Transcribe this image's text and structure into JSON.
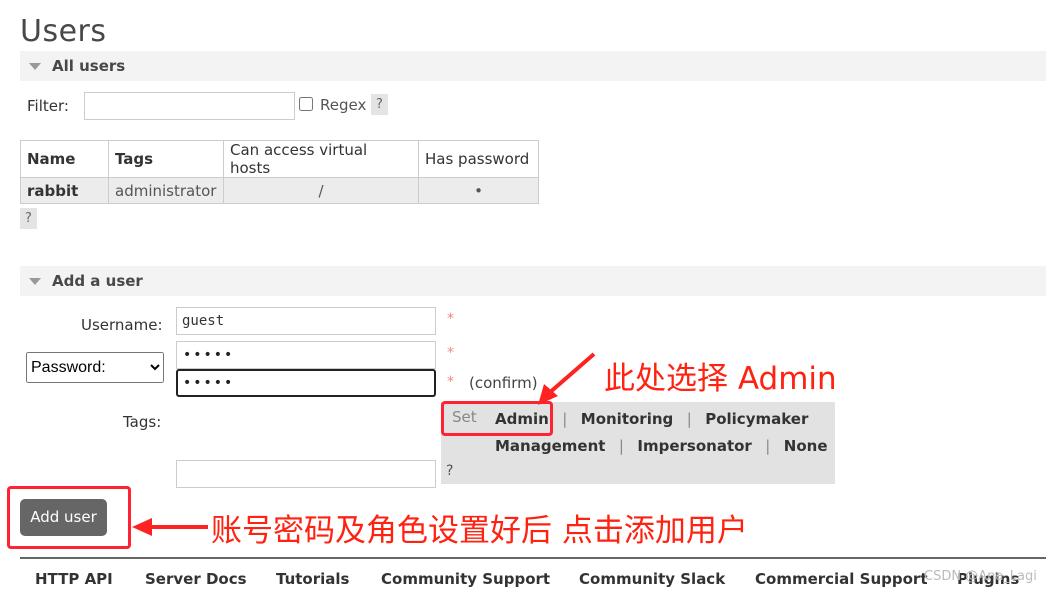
{
  "page": {
    "title": "Users"
  },
  "all_users": {
    "section_label": "All users",
    "filter_label": "Filter:",
    "filter_value": "",
    "regex_label": "Regex",
    "help": "?",
    "table": {
      "headers": [
        "Name",
        "Tags",
        "Can access virtual hosts",
        "Has password"
      ],
      "rows": [
        {
          "name": "rabbit",
          "tags": "administrator",
          "vhosts": "/",
          "has_password": "•"
        }
      ]
    },
    "table_help": "?"
  },
  "add_user": {
    "section_label": "Add a user",
    "username_label": "Username:",
    "username_value": "guest",
    "password_mode": "Password:",
    "password_value": "•••••",
    "confirm_value": "•••••",
    "required_mark": "*",
    "confirm_label": "(confirm)",
    "tags_label": "Tags:",
    "tags_value": "",
    "tags_help": "?",
    "set_label": "Set",
    "tag_options_row1": [
      "Admin",
      "Monitoring",
      "Policymaker"
    ],
    "tag_options_row2": [
      "Management",
      "Impersonator",
      "None"
    ],
    "separator": "|",
    "submit_label": "Add user"
  },
  "annotations": {
    "admin_note": "此处选择 Admin",
    "submit_note": "账号密码及角色设置好后 点击添加用户",
    "accent_color": "#ff2222"
  },
  "footer": {
    "links": [
      "HTTP API",
      "Server Docs",
      "Tutorials",
      "Community Support",
      "Community Slack",
      "Commercial Support",
      "Plugins"
    ]
  },
  "watermark": "CSDN @Ana_Lagi"
}
